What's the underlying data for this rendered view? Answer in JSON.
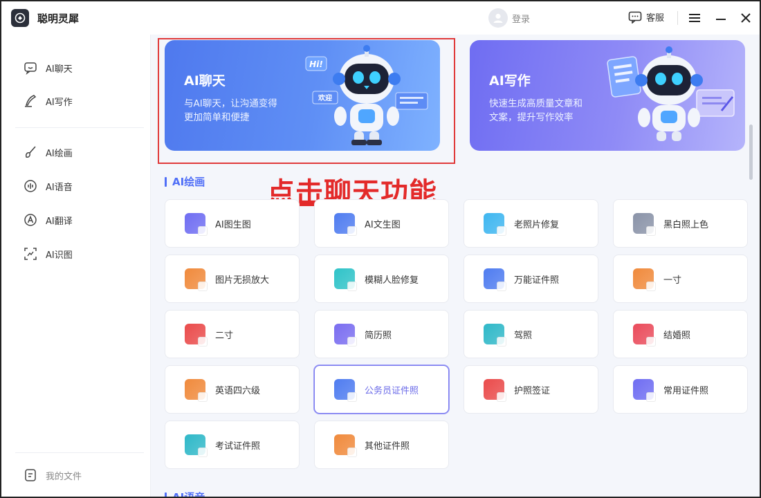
{
  "app": {
    "title": "聪明灵犀"
  },
  "titlebar": {
    "login_label": "登录",
    "service_label": "客服"
  },
  "sidebar": {
    "items": [
      {
        "label": "AI聊天",
        "icon": "chat-icon"
      },
      {
        "label": "AI写作",
        "icon": "pen-icon"
      },
      {
        "label": "AI绘画",
        "icon": "brush-icon"
      },
      {
        "label": "AI语音",
        "icon": "voice-icon"
      },
      {
        "label": "AI翻译",
        "icon": "translate-icon"
      },
      {
        "label": "AI识图",
        "icon": "scan-icon"
      }
    ],
    "files_label": "我的文件"
  },
  "banners": {
    "chat": {
      "title": "AI聊天",
      "desc_line1": "与AI聊天，让沟通变得",
      "desc_line2": "更加简单和便捷",
      "bubble_hi": "Hi!",
      "bubble_welcome": "欢迎"
    },
    "write": {
      "title": "AI写作",
      "desc_line1": "快速生成高质量文章和",
      "desc_line2": "文案，提升写作效率"
    }
  },
  "annotation": {
    "text": "点击聊天功能",
    "color": "#e32a2a"
  },
  "sections": {
    "painting": {
      "title": "AI绘画",
      "cards": [
        {
          "label": "AI图生图",
          "color": "#6f6df2"
        },
        {
          "label": "AI文生图",
          "color": "#4f7cf0"
        },
        {
          "label": "老照片修复",
          "color": "#3eb6f0"
        },
        {
          "label": "黑白照上色",
          "color": "#8a93a8"
        },
        {
          "label": "图片无损放大",
          "color": "#f08a3c"
        },
        {
          "label": "模糊人脸修复",
          "color": "#2fc3c8"
        },
        {
          "label": "万能证件照",
          "color": "#4f7cf0"
        },
        {
          "label": "一寸",
          "color": "#f08a3c"
        },
        {
          "label": "二寸",
          "color": "#ea4b4b"
        },
        {
          "label": "简历照",
          "color": "#7a6df0"
        },
        {
          "label": "驾照",
          "color": "#2fb8c8"
        },
        {
          "label": "结婚照",
          "color": "#ea4b5b"
        },
        {
          "label": "英语四六级",
          "color": "#f08a3c"
        },
        {
          "label": "公务员证件照",
          "color": "#4f7cf0"
        },
        {
          "label": "护照签证",
          "color": "#ea4b4b"
        },
        {
          "label": "常用证件照",
          "color": "#6f6df2"
        },
        {
          "label": "考试证件照",
          "color": "#2fb8c8"
        },
        {
          "label": "其他证件照",
          "color": "#f08a3c"
        }
      ]
    },
    "voice": {
      "title": "AI语音"
    }
  },
  "colors": {
    "accent": "#4f6ef7",
    "highlight_border": "#e03a3a"
  }
}
